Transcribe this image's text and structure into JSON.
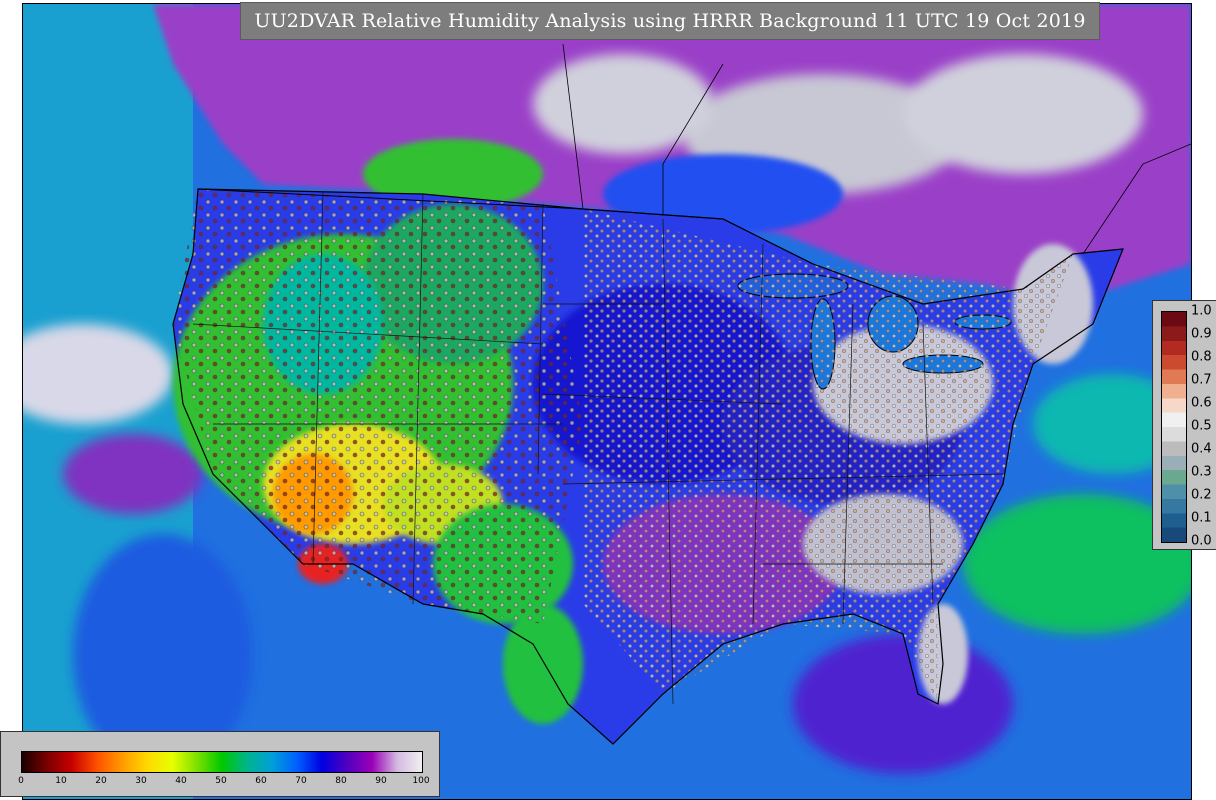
{
  "title": "UU2DVAR Relative Humidity Analysis using HRRR Background 11 UTC 19 Oct 2019",
  "rh_colorbar": {
    "ticks": [
      "0",
      "10",
      "20",
      "30",
      "40",
      "50",
      "60",
      "70",
      "80",
      "90",
      "100"
    ],
    "colors": [
      "#1a0000",
      "#7a0000",
      "#c80000",
      "#ff5000",
      "#ff9a00",
      "#ffd800",
      "#e8ff00",
      "#7ee000",
      "#00c800",
      "#00b48c",
      "#00a0d8",
      "#0060ff",
      "#0000e0",
      "#5000c0",
      "#9a00b8",
      "#d4b8e0",
      "#f0f0f0"
    ]
  },
  "station_colorbar": {
    "ticks": [
      "1.0",
      "0.9",
      "0.8",
      "0.7",
      "0.6",
      "0.5",
      "0.4",
      "0.3",
      "0.2",
      "0.1",
      "0.0"
    ],
    "colors": [
      "#6b0a12",
      "#8c1a1a",
      "#b22a22",
      "#cc4a30",
      "#e07a55",
      "#f0b090",
      "#f5d8c8",
      "#f0f0f0",
      "#dcdcdc",
      "#bcbcbc",
      "#9aaeb8",
      "#6aa890",
      "#4f8fa8",
      "#3578a0",
      "#1f5f90",
      "#174a7a"
    ]
  },
  "map": {
    "ocean_color": "#1f8fe0",
    "canada_color": "#b8b8c8"
  }
}
